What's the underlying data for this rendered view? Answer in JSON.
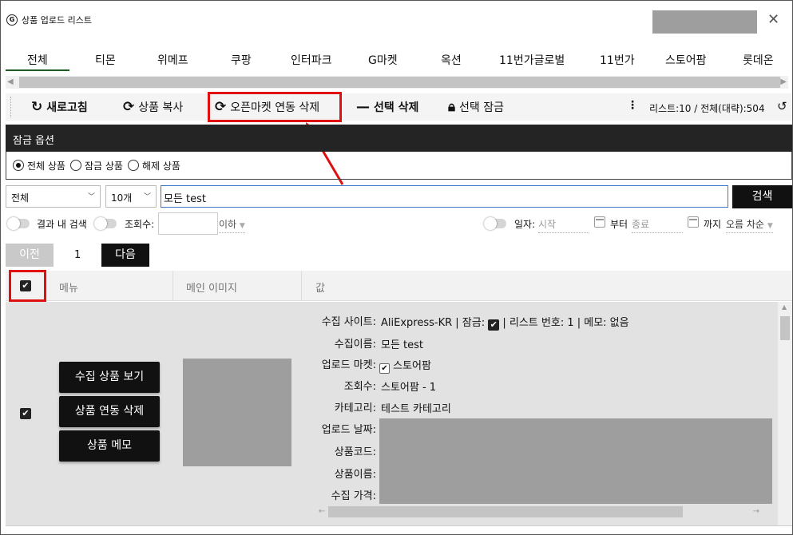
{
  "window": {
    "title": "상품 업로드 리스트",
    "icon": "app-logo-icon",
    "close": "✕"
  },
  "tabs": [
    "전체",
    "티몬",
    "위메프",
    "쿠팡",
    "인터파크",
    "G마켓",
    "옥션",
    "11번가글로벌",
    "11번가",
    "스토어팜",
    "롯데온"
  ],
  "active_tab": "전체",
  "toolbar": {
    "refresh": "새로고침",
    "copy": "상품 복사",
    "openmarket_delete": "오픈마켓 연동 삭제",
    "selected_delete": "선택 삭제",
    "selected_lock": "선택 잠금",
    "more": "⋮",
    "list_info": "리스트:10  /  전체(대략):504"
  },
  "lock_options": {
    "header": "잠금 옵션",
    "options": [
      "전체 상품",
      "잠금 상품",
      "해제 상품"
    ],
    "selected": "전체 상품"
  },
  "search": {
    "category": "전체",
    "count": "10개",
    "query": "모든 test",
    "button": "검색"
  },
  "filters": {
    "in_result": "결과 내 검색",
    "views_label": "조회수:",
    "below": "이하",
    "date_label": "일자:",
    "start_placeholder": "시작",
    "from": "부터",
    "end_placeholder": "종료",
    "until": "까지",
    "order": "오름 차순"
  },
  "pager": {
    "prev": "이전",
    "page": "1",
    "next": "다음"
  },
  "table": {
    "headers": [
      "메뉴",
      "메인 이미지",
      "값"
    ]
  },
  "row": {
    "buttons": [
      "수집 상품 보기",
      "상품 연동 삭제",
      "상품 메모"
    ],
    "fields": {
      "site_label": "수집 사이트:",
      "site_value": "AliExpress-KR",
      "lock_label": "| 잠금:",
      "list_no": "| 리스트 번호: 1 | 메모: 없음",
      "name_label": "수집이름:",
      "name_value": "모든 test",
      "market_label": "업로드 마켓:",
      "market_value": "스토어팜",
      "views_label": "조회수:",
      "views_value": "스토어팜  -  1",
      "category_label": "카테고리:",
      "category_value": "테스트 카테고리",
      "date_label": "업로드 날짜:",
      "code_label": "상품코드:",
      "pname_label": "상품이름:",
      "price_label": "수집 가격:"
    }
  },
  "colors": {
    "highlight": "#e01010",
    "dark": "#111111",
    "tab_underline": "#1b5e20",
    "input_border": "#3d78c8"
  }
}
